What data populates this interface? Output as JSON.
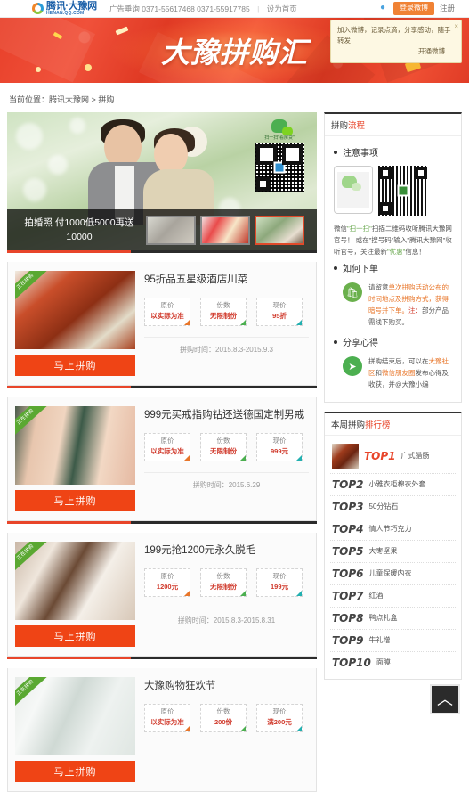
{
  "topbar": {
    "logo_cn": "腾讯·大豫网",
    "logo_en": "HENAN.QQ.COM",
    "ads": "广告垂询 0371-55617468 0371-55917785",
    "separator": "|",
    "set_home": "设为首页",
    "qq_icon": "qq-penguin-icon",
    "login_label": "登录微博",
    "register_label": "注册"
  },
  "notify": {
    "line1": "加入微博，记录点滴，分享感动，随手转发",
    "line2": "开通微博",
    "close": "×"
  },
  "hero": {
    "title": "大豫拼购汇"
  },
  "breadcrumb": {
    "prefix": "当前位置：",
    "site": "腾讯大豫网",
    "arrow": ">",
    "current": "拼购"
  },
  "promo": {
    "caption_line1": "拍婚照 付1000低5000再送",
    "caption_line2": "10000",
    "qr_caption": "扫一扫\"看房贷\"",
    "wechat_icon": "wechat-icon",
    "thumbs": [
      {
        "name": "thumb-rings"
      },
      {
        "name": "thumb-cosmetics"
      },
      {
        "name": "thumb-wedding"
      }
    ]
  },
  "labels": {
    "price_original": "原价",
    "price_count": "份数",
    "price_current": "现价",
    "time_prefix": "拼购时间：",
    "buy_button": "马上拼购",
    "ribbon": "正在拼购"
  },
  "products": [
    {
      "title": "95折品五星级酒店川菜",
      "original": "以实际为准",
      "count": "无限制份",
      "current": "95折",
      "time": "2015.8.3-2015.9.3",
      "img": "img-food"
    },
    {
      "title": "999元买戒指购钻还送德国定制男戒",
      "original": "以实际为准",
      "count": "无限制份",
      "current": "999元",
      "time": "2015.6.29",
      "img": "img-ring"
    },
    {
      "title": "199元抢1200元永久脱毛",
      "original": "1200元",
      "count": "无限制份",
      "current": "199元",
      "time": "2015.8.3-2015.8.31",
      "img": "img-spa"
    },
    {
      "title": "大豫购物狂欢节",
      "original": "以实际为准",
      "count": "200份",
      "current": "满200元",
      "time": "",
      "img": "img-cos"
    }
  ],
  "sidebar": {
    "flow_title_a": "拼购",
    "flow_title_b": "流程",
    "sec_notice": "注意事项",
    "wx_text_1": "微信",
    "wx_text_2": "\"扫一扫\"",
    "wx_text_3": "扫描二维码收听腾讯大豫网官号！",
    "wx_text_4": "或在\"搜号码\"输入\"腾讯大豫网\"收听官号，关注最新",
    "wx_text_5": "\"优惠\"",
    "wx_text_6": "信息！",
    "sec_order": "如何下单",
    "order_text_1": "请留意",
    "order_text_2": "单次拼购活动公布的时间地点及拼购方式，获得暗号并下单。",
    "order_text_3": "注：",
    "order_text_4": "部分产品需线下购买。",
    "sec_share": "分享心得",
    "share_text_1": "拼购结束后，可以在",
    "share_text_2": "大豫社区",
    "share_text_3": "和",
    "share_text_4": "微信朋友圈",
    "share_text_5": "发布心得及收获，并@大豫小编",
    "rank_title_a": "本周拼购",
    "rank_title_b": "排行榜",
    "ranks": [
      {
        "num": "TOP1",
        "name": "广式腊肠",
        "has_thumb": true
      },
      {
        "num": "TOP2",
        "name": "小雅衣柜棉衣外套",
        "has_thumb": false
      },
      {
        "num": "TOP3",
        "name": "50分钻石",
        "has_thumb": false
      },
      {
        "num": "TOP4",
        "name": "情人节巧克力",
        "has_thumb": false
      },
      {
        "num": "TOP5",
        "name": "大枣坚果",
        "has_thumb": false
      },
      {
        "num": "TOP6",
        "name": "儿童保暖内衣",
        "has_thumb": false
      },
      {
        "num": "TOP7",
        "name": "红酒",
        "has_thumb": false
      },
      {
        "num": "TOP8",
        "name": "鸭点礼盒",
        "has_thumb": false
      },
      {
        "num": "TOP9",
        "name": "牛礼增",
        "has_thumb": false
      },
      {
        "num": "TOP10",
        "name": "面膜",
        "has_thumb": false
      }
    ]
  },
  "back_top": {
    "icon": "chevron-up-icon",
    "glyph": "︿"
  },
  "colors": {
    "brand_red": "#e8452a",
    "buy_orange": "#ef4415",
    "login_orange": "#f08234",
    "green": "#5aa832",
    "dark": "#2b2b2b"
  }
}
